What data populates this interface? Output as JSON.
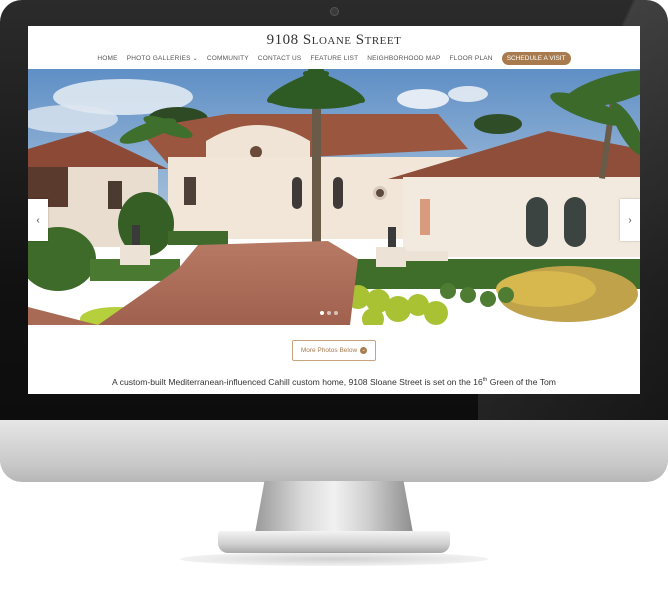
{
  "site": {
    "title": "9108 Sloane Street"
  },
  "nav": {
    "items": [
      {
        "label": "HOME"
      },
      {
        "label": "PHOTO GALLERIES"
      },
      {
        "label": "COMMUNITY"
      },
      {
        "label": "CONTACT US"
      },
      {
        "label": "FEATURE LIST"
      },
      {
        "label": "NEIGHBORHOOD MAP"
      },
      {
        "label": "FLOOR PLAN"
      }
    ],
    "gallery_caret": "⌄",
    "cta_label": "SCHEDULE A VISIT"
  },
  "slider": {
    "prev_symbol": "‹",
    "next_symbol": "›"
  },
  "content": {
    "more_button": "More Photos Below",
    "more_icon": "⌄",
    "intro_part1": "A custom-built Mediterranean-influenced Cahill custom home, 9108 Sloane Street is set on the 16",
    "intro_sup": "th",
    "intro_part2": " Green of the Tom"
  },
  "colors": {
    "accent": "#a87b4f",
    "frame": "#111111"
  },
  "icons": [
    "chevron-down-icon",
    "chevron-left-icon",
    "chevron-right-icon",
    "arrow-circle-down-icon"
  ]
}
